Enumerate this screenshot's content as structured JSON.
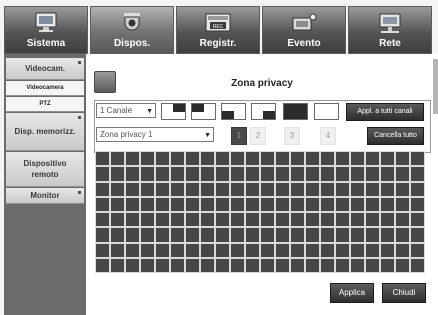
{
  "top_tabs": [
    {
      "label": "Sistema",
      "icon": "monitor-icon"
    },
    {
      "label": "Dispos.",
      "icon": "camera-icon"
    },
    {
      "label": "Registr.",
      "icon": "rec-icon"
    },
    {
      "label": "Evento",
      "icon": "event-icon"
    },
    {
      "label": "Rete",
      "icon": "network-icon"
    }
  ],
  "active_tab": "Dispos.",
  "sidebar": {
    "items": [
      {
        "label": "Videocam."
      },
      {
        "label": "Videocamera"
      },
      {
        "label": "PTZ"
      },
      {
        "label": "Disp. memorizz."
      },
      {
        "label": "Dispositivo remoto"
      },
      {
        "label": "Monitor"
      }
    ]
  },
  "panel": {
    "title": "Zona privacy",
    "channel_select": "1 Canale",
    "zone_select": "Zona privacy 1",
    "apply_all_label": "Appl. a tutti canali",
    "clear_all_label": "Cancella tutto",
    "zone_numbers": [
      "1",
      "2",
      "3",
      "4"
    ],
    "active_zone": "1"
  },
  "footer": {
    "apply_label": "Applica",
    "close_label": "Chiudi"
  },
  "colors": {
    "accent_dark": "#2e2e2e",
    "mask_cell": "#464646",
    "tab_gradient_top": "#9a9a9a"
  }
}
